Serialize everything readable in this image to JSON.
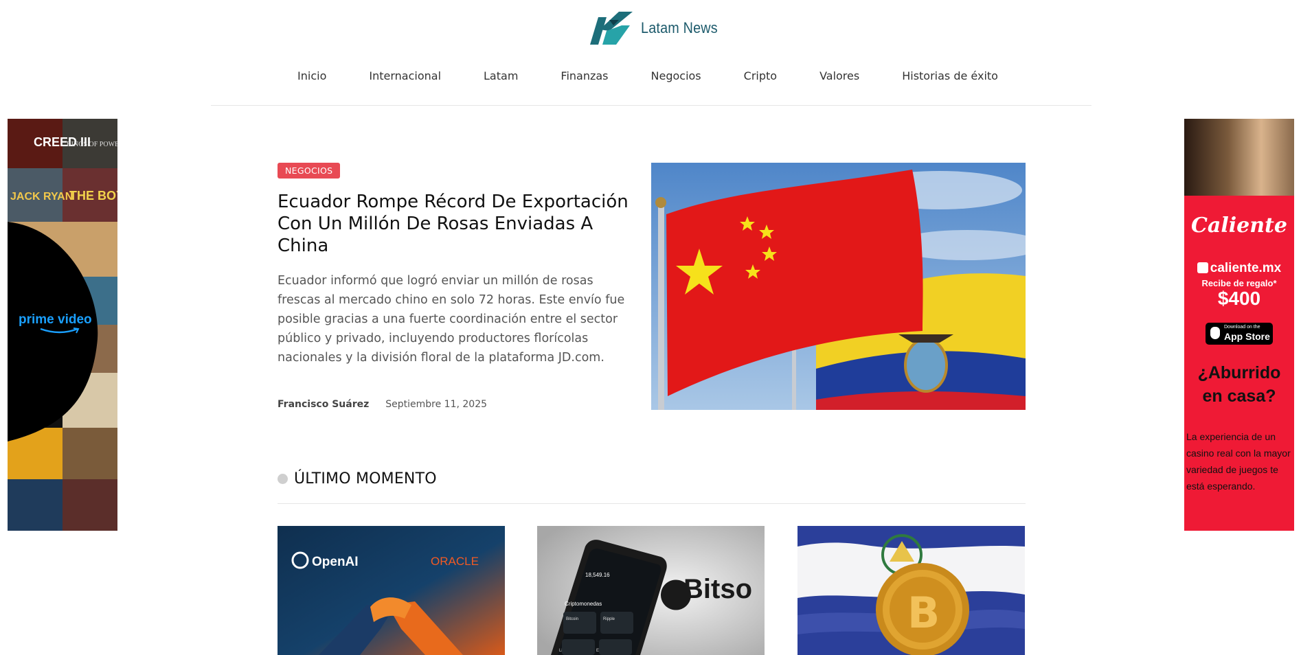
{
  "site": {
    "name": "Latam News"
  },
  "nav": {
    "items": [
      "Inicio",
      "Internacional",
      "Latam",
      "Finanzas",
      "Negocios",
      "Cripto",
      "Valores",
      "Historias de éxito"
    ]
  },
  "ads": {
    "left": {
      "brand": "prime video",
      "tiles": [
        "CREED III",
        "RINGS OF POWER",
        "JACK RYAN",
        "THE BOYS"
      ]
    },
    "right": {
      "brand": "Caliente",
      "site": "caliente.mx",
      "offer_line": "Recibe de regalo*",
      "offer_amount": "$400",
      "store_small": "Download on the",
      "store_big": "App Store",
      "headline_1": "¿Aburrido",
      "headline_2": "en casa?",
      "body": "La experiencia de un casino real con la mayor variedad de juegos te está esperando."
    }
  },
  "featured": {
    "category": "NEGOCIOS",
    "title": "Ecuador Rompe Récord De Exportación Con Un Millón De Rosas Enviadas A China",
    "excerpt": "Ecuador informó que logró enviar un millón de rosas frescas al mercado chino en solo 72 horas. Este envío fue posible gracias a una fuerte coordinación entre el sector público y privado, incluyendo productores florícolas nacionales y la división floral de la plataforma JD.com.",
    "author": "Francisco Suárez",
    "date": "Septiembre 11, 2025"
  },
  "latest": {
    "title": "ÚLTIMO MOMENTO",
    "cards": [
      {
        "left_logo": "OpenAI",
        "right_logo": "ORACLE"
      },
      {
        "logo": "Bitso",
        "balance": "18,549.16",
        "section": "Criptomonedas",
        "coin_1": "Bitcoin",
        "coin_2": "Ripple",
        "coin_3": "Litecoin",
        "coin_4": "Ethereum"
      },
      {
        "coin": "B"
      }
    ]
  },
  "colors": {
    "badge": "#e84a54",
    "logo_teal": "#1c5a6b",
    "ad_red": "#ef1a35"
  }
}
